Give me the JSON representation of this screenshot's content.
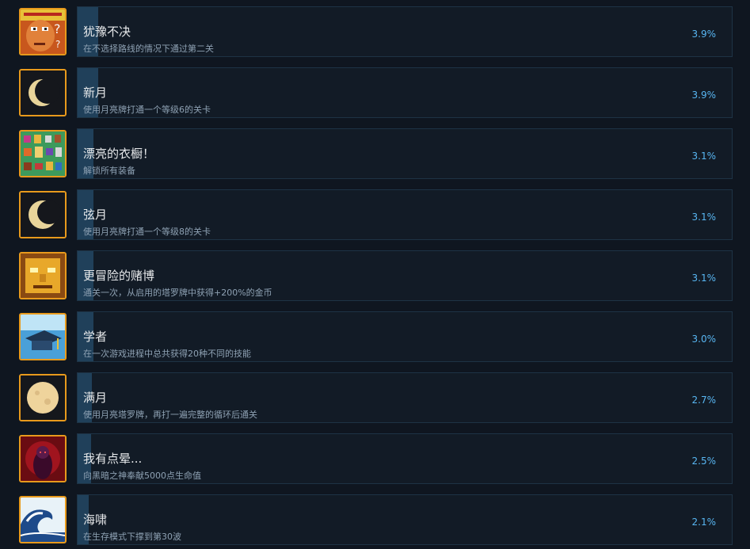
{
  "achievements": [
    {
      "title": "犹豫不决",
      "description": "在不选择路线的情况下通过第二关",
      "percent": "3.9%",
      "rate": 3.9,
      "icon": "hesitant-face-icon"
    },
    {
      "title": "新月",
      "description": "使用月亮牌打通一个等级6的关卡",
      "percent": "3.9%",
      "rate": 3.9,
      "icon": "crescent-moon-icon"
    },
    {
      "title": "漂亮的衣橱！",
      "description": "解锁所有装备",
      "percent": "3.1%",
      "rate": 3.1,
      "icon": "wardrobe-equipment-icon"
    },
    {
      "title": "弦月",
      "description": "使用月亮牌打通一个等级8的关卡",
      "percent": "3.1%",
      "rate": 3.1,
      "icon": "half-moon-icon"
    },
    {
      "title": "更冒险的赌博",
      "description": "通关一次，从启用的塔罗牌中获得+200%的金币",
      "percent": "3.1%",
      "rate": 3.1,
      "icon": "golden-face-icon"
    },
    {
      "title": "学者",
      "description": "在一次游戏进程中总共获得20种不同的技能",
      "percent": "3.0%",
      "rate": 3.0,
      "icon": "scholar-cap-icon"
    },
    {
      "title": "满月",
      "description": "使用月亮塔罗牌，再打一遍完整的循环后通关",
      "percent": "2.7%",
      "rate": 2.7,
      "icon": "full-moon-icon"
    },
    {
      "title": "我有点晕...",
      "description": "向黑暗之神奉献5000点生命值",
      "percent": "2.5%",
      "rate": 2.5,
      "icon": "dark-god-icon"
    },
    {
      "title": "海啸",
      "description": "在生存模式下撑到第30波",
      "percent": "2.1%",
      "rate": 2.1,
      "icon": "tsunami-wave-icon"
    }
  ]
}
